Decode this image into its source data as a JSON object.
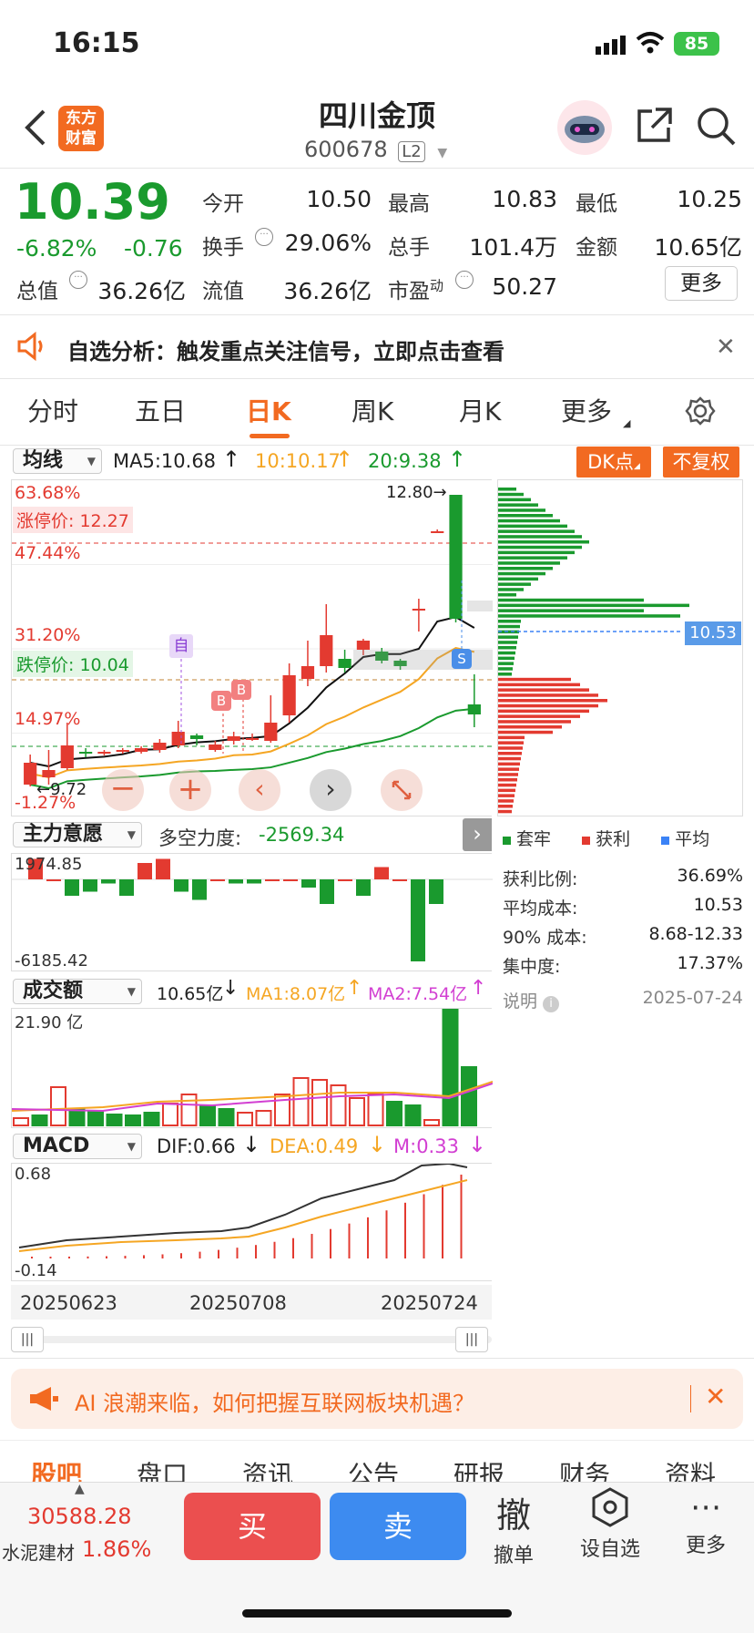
{
  "status": {
    "time": "16:15",
    "battery": "85"
  },
  "header": {
    "title": "四川金顶",
    "code": "600678",
    "l2": "L2",
    "logo": "东方\n财富"
  },
  "quote": {
    "price": "10.39",
    "pct": "-6.82%",
    "chg": "-0.76",
    "open_l": "今开",
    "open": "10.50",
    "high_l": "最高",
    "high": "10.83",
    "low_l": "最低",
    "low": "10.25",
    "turn_l": "换手",
    "turn": "29.06%",
    "vol_l": "总手",
    "vol": "101.4万",
    "amt_l": "金额",
    "amt": "10.65亿",
    "mcap_l": "总值",
    "mcap": "36.26亿",
    "fcap_l": "流值",
    "fcap": "36.26亿",
    "pe_l": "市盈",
    "pe_sup": "动",
    "pe": "50.27",
    "more": "更多"
  },
  "banner": {
    "text": "自选分析：触发重点关注信号，立即点击查看"
  },
  "tabs": [
    "分时",
    "五日",
    "日K",
    "周K",
    "月K",
    "更多"
  ],
  "kline": {
    "ma_type": "均线",
    "ma5": "MA5:10.68",
    "ma10": "10:10.17",
    "ma20": "20:9.38",
    "dk": "DK点",
    "fq": "不复权",
    "y_labels": [
      "63.68%",
      "47.44%",
      "31.20%",
      "14.97%",
      "-1.27%"
    ],
    "limit_up": "涨停价: 12.27",
    "limit_down": "跌停价: 10.04",
    "max_label": "12.80",
    "min_label": "9.72",
    "mark_zi": "自",
    "mark_b1": "B",
    "mark_b2": "B",
    "mark_s": "S",
    "chip_price": "10.53"
  },
  "chart_data": {
    "type": "candlestick",
    "candles": [
      {
        "o": 9.62,
        "c": 9.86,
        "h": 9.95,
        "l": 9.6
      },
      {
        "o": 9.7,
        "c": 9.78,
        "h": 10.0,
        "l": 9.62
      },
      {
        "o": 9.8,
        "c": 10.05,
        "h": 10.3,
        "l": 9.78
      },
      {
        "o": 9.98,
        "c": 9.96,
        "h": 10.02,
        "l": 9.92
      },
      {
        "o": 9.96,
        "c": 9.98,
        "h": 10.0,
        "l": 9.94
      },
      {
        "o": 9.99,
        "c": 10.0,
        "h": 10.02,
        "l": 9.96
      },
      {
        "o": 9.98,
        "c": 10.02,
        "h": 10.04,
        "l": 9.96
      },
      {
        "o": 10.0,
        "c": 10.08,
        "h": 10.12,
        "l": 9.97
      },
      {
        "o": 10.05,
        "c": 10.2,
        "h": 10.32,
        "l": 10.02
      },
      {
        "o": 10.16,
        "c": 10.12,
        "h": 10.18,
        "l": 10.05
      },
      {
        "o": 10.0,
        "c": 10.06,
        "h": 10.1,
        "l": 9.98
      },
      {
        "o": 10.1,
        "c": 10.15,
        "h": 10.2,
        "l": 10.06
      },
      {
        "o": 10.12,
        "c": 10.13,
        "h": 10.18,
        "l": 10.1
      },
      {
        "o": 10.1,
        "c": 10.3,
        "h": 10.6,
        "l": 10.08
      },
      {
        "o": 10.38,
        "c": 10.82,
        "h": 10.95,
        "l": 10.3
      },
      {
        "o": 10.78,
        "c": 10.92,
        "h": 11.2,
        "l": 10.7
      },
      {
        "o": 10.92,
        "c": 11.26,
        "h": 11.6,
        "l": 10.85
      },
      {
        "o": 11.0,
        "c": 10.9,
        "h": 11.1,
        "l": 10.85
      },
      {
        "o": 11.1,
        "c": 11.2,
        "h": 11.22,
        "l": 11.04
      },
      {
        "o": 11.08,
        "c": 10.98,
        "h": 11.12,
        "l": 10.95
      },
      {
        "o": 10.98,
        "c": 10.92,
        "h": 11.0,
        "l": 10.88
      },
      {
        "o": 11.55,
        "c": 11.55,
        "h": 11.66,
        "l": 11.3
      },
      {
        "o": 12.4,
        "c": 12.4,
        "h": 12.42,
        "l": 12.4
      },
      {
        "o": 12.8,
        "c": 11.44,
        "h": 12.8,
        "l": 11.4
      },
      {
        "o": 10.5,
        "c": 10.39,
        "h": 10.83,
        "l": 10.25
      }
    ]
  },
  "indicators": {
    "zl": {
      "name": "主力意愿",
      "label": "多空力度:",
      "value": "-2569.34",
      "top": "1974.85",
      "bottom": "-6185.42"
    },
    "amt": {
      "name": "成交额",
      "value": "10.65亿",
      "ma1": "MA1:8.07亿",
      "ma2": "MA2:7.54亿",
      "top": "21.90 亿"
    },
    "macd": {
      "name": "MACD",
      "dif": "DIF:0.66",
      "dea": "DEA:0.49",
      "m": "M:0.33",
      "top": "0.68",
      "bottom": "-0.14"
    },
    "dates": [
      "20250623",
      "20250708",
      "20250724"
    ]
  },
  "chips": {
    "legend": [
      "套牢",
      "获利",
      "平均"
    ],
    "rows": [
      [
        "获利比例:",
        "36.69%"
      ],
      [
        "平均成本:",
        "10.53"
      ],
      [
        "90% 成本:",
        "8.68-12.33"
      ],
      [
        "集中度:",
        "17.37%"
      ]
    ],
    "note": "说明",
    "date": "2025-07-24"
  },
  "ad": {
    "text": "AI 浪潮来临，如何把握互联网板块机遇？"
  },
  "bottom_tabs": [
    "股吧",
    "盘口",
    "资讯",
    "公告",
    "研报",
    "财务",
    "资料"
  ],
  "footer": {
    "index": "30588.28",
    "sector": "水泥建材",
    "sector_pct": "1.86%",
    "buy": "买",
    "sell": "卖",
    "cancel_icon": "撤",
    "cancel": "撤单",
    "fav": "设自选",
    "more": "更多"
  },
  "colors": {
    "red": "#e33a30",
    "green": "#1a9a2e",
    "orange": "#f26a21",
    "blue": "#3b82f6"
  }
}
